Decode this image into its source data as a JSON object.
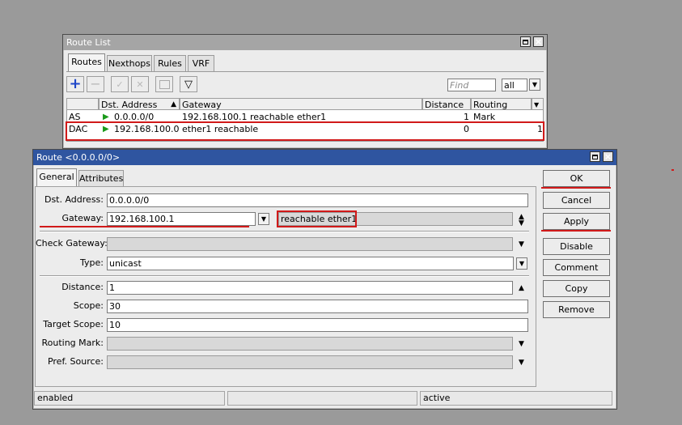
{
  "route_list": {
    "title": "Route List",
    "tabs": [
      "Routes",
      "Nexthops",
      "Rules",
      "VRF"
    ],
    "find_placeholder": "Find",
    "filter_value": "all",
    "columns": [
      "",
      "Dst. Address",
      "Gateway",
      "Distance",
      "Routing Mark"
    ],
    "rows": [
      {
        "flags": "AS",
        "dst": "0.0.0.0/0",
        "gateway": "192.168.100.1 reachable ether1",
        "distance": "1",
        "routing_mark": "",
        "extra": ""
      },
      {
        "flags": "DAC",
        "dst": "192.168.100.0...",
        "gateway": "ether1 reachable",
        "distance": "0",
        "routing_mark": "",
        "extra": "1"
      }
    ]
  },
  "route_dialog": {
    "title": "Route <0.0.0.0/0>",
    "tabs": [
      "General",
      "Attributes"
    ],
    "fields": {
      "dst_address": {
        "label": "Dst. Address:",
        "value": "0.0.0.0/0"
      },
      "gateway": {
        "label": "Gateway:",
        "value": "192.168.100.1",
        "status": "reachable ether1"
      },
      "check_gateway": {
        "label": "Check Gateway:",
        "value": ""
      },
      "type": {
        "label": "Type:",
        "value": "unicast"
      },
      "distance": {
        "label": "Distance:",
        "value": "1"
      },
      "scope": {
        "label": "Scope:",
        "value": "30"
      },
      "target_scope": {
        "label": "Target Scope:",
        "value": "10"
      },
      "routing_mark": {
        "label": "Routing Mark:",
        "value": ""
      },
      "pref_source": {
        "label": "Pref. Source:",
        "value": ""
      }
    },
    "buttons": [
      "OK",
      "Cancel",
      "Apply",
      "Disable",
      "Comment",
      "Copy",
      "Remove"
    ],
    "status": [
      "enabled",
      "",
      "active"
    ]
  },
  "colors": {
    "annotation": "#d11a1a",
    "dialog_title": "#2f55a0",
    "inactive_title": "#a5a5a5",
    "route_flag": "#1a9a1a"
  }
}
